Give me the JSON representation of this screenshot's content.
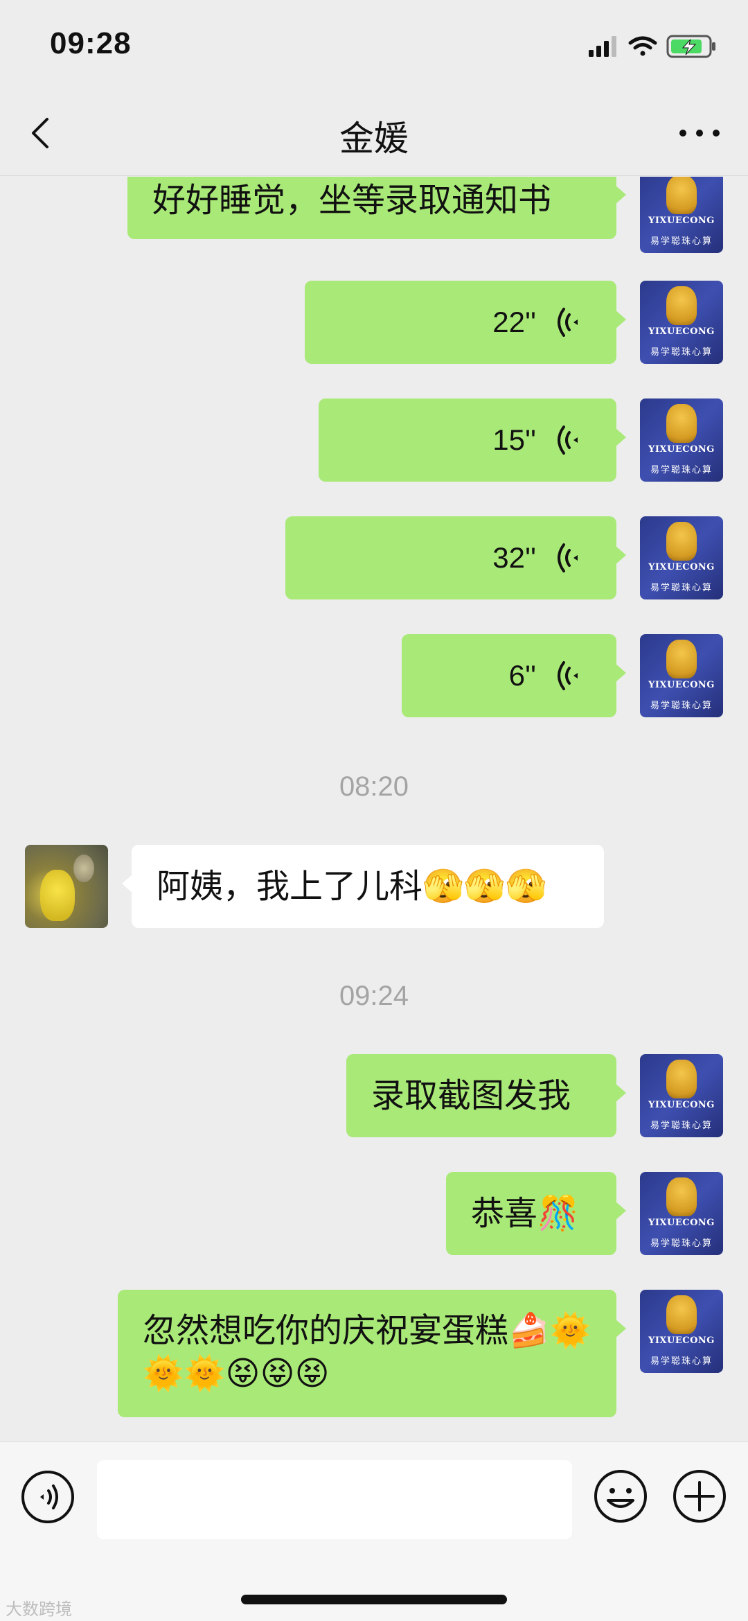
{
  "status_bar": {
    "time": "09:28",
    "battery": "charging"
  },
  "nav": {
    "title": "金媛",
    "back_icon": "chevron-left-icon",
    "more_icon": "more-dots-icon"
  },
  "messages": [
    {
      "side": "me",
      "type": "text",
      "text": "好好睡觉，坐等录取通知书"
    },
    {
      "side": "me",
      "type": "voice",
      "duration": "22''"
    },
    {
      "side": "me",
      "type": "voice",
      "duration": "15''"
    },
    {
      "side": "me",
      "type": "voice",
      "duration": "32''"
    },
    {
      "side": "me",
      "type": "voice",
      "duration": "6''"
    },
    {
      "type": "timestamp",
      "text": "08:20"
    },
    {
      "side": "other",
      "type": "text",
      "text": "阿姨，我上了儿科🫣🫣🫣"
    },
    {
      "type": "timestamp",
      "text": "09:24"
    },
    {
      "side": "me",
      "type": "text",
      "text": "录取截图发我"
    },
    {
      "side": "me",
      "type": "text",
      "text": "恭喜🎊"
    },
    {
      "side": "me",
      "type": "text",
      "text": "忽然想吃你的庆祝宴蛋糕🍰🌞🌞🌞😝😝😝"
    }
  ],
  "avatars": {
    "me_logo_text": "YIXUECONG",
    "me_logo_sub": "易学聪珠心算"
  },
  "input_bar": {
    "placeholder": "",
    "voice_icon": "voice-input-icon",
    "emoji_icon": "emoji-icon",
    "plus_icon": "plus-icon"
  },
  "watermark": "大数跨境",
  "colors": {
    "bubble_me": "#a9e977",
    "bubble_other": "#ffffff",
    "background": "#ededed"
  }
}
